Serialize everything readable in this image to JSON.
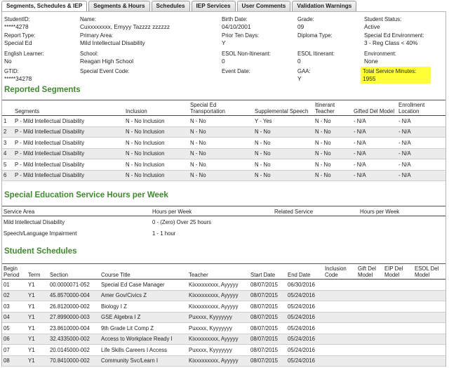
{
  "tabs": [
    {
      "label": "Segments, Schedules & IEP",
      "active": true
    },
    {
      "label": "Segments & Hours",
      "active": false
    },
    {
      "label": "Schedules",
      "active": false
    },
    {
      "label": "IEP Services",
      "active": false
    },
    {
      "label": "User Comments",
      "active": false
    },
    {
      "label": "Validation Warnings",
      "active": false
    }
  ],
  "student": {
    "student_id_label": "StudentID:",
    "student_id": "*****4278",
    "name_label": "Name:",
    "name": "Cuxxxxxxxx, Emyyy Tazzzz zzzzzz",
    "birth_label": "Birth Date:",
    "birth": "04/10/2001",
    "grade_label": "Grade:",
    "grade": "09",
    "status_label": "Student Status:",
    "status": "Active",
    "report_type_label": "Report Type:",
    "report_type": "Special Ed",
    "primary_area_label": "Primary Area:",
    "primary_area": "Mild Intellectual Disability",
    "prior_days_label": "Prior Ten Days:",
    "prior_days": "Y",
    "diploma_label": "Diploma Type:",
    "diploma": "",
    "sped_env_label": "Special Ed Environment:",
    "sped_env": "3 - Reg Class < 40%",
    "el_label": "English Learner:",
    "el": "No",
    "school_label": "School:",
    "school": "Reagan High School",
    "esol_non_label": "ESOL Non-Itinerant:",
    "esol_non": "0",
    "esol_itin_label": "ESOL Itinerant:",
    "esol_itin": "0",
    "environment_label": "Environment:",
    "environment": "None",
    "gtid_label": "GTID:",
    "gtid": "*****34278",
    "special_event_label": "Special Event Code:",
    "special_event": "",
    "event_date_label": "Event Date:",
    "event_date": "",
    "gaa_label": "GAA:",
    "gaa": "Y",
    "total_minutes_label": "Total Service Minutes:",
    "total_minutes": "1955"
  },
  "reported_segments": {
    "title": "Reported Segments",
    "headers": [
      "",
      "Segments",
      "Inclusion",
      "Special Ed Transportation",
      "Supplemental Speech",
      "Itinerant Teacher",
      "Gifted Del Model",
      "Enrollment Location"
    ],
    "rows": [
      [
        "1",
        "P - Mild Intellectual Disability",
        "N - No Inclusion",
        "N - No",
        "Y - Yes",
        "N - No",
        "- N/A",
        "- N/A"
      ],
      [
        "2",
        "P - Mild Intellectual Disability",
        "N - No Inclusion",
        "N - No",
        "N - No",
        "N - No",
        "- N/A",
        "- N/A"
      ],
      [
        "3",
        "P - Mild Intellectual Disability",
        "N - No Inclusion",
        "N - No",
        "N - No",
        "N - No",
        "- N/A",
        "- N/A"
      ],
      [
        "4",
        "P - Mild Intellectual Disability",
        "N - No Inclusion",
        "N - No",
        "N - No",
        "N - No",
        "- N/A",
        "- N/A"
      ],
      [
        "5",
        "P - Mild Intellectual Disability",
        "N - No Inclusion",
        "N - No",
        "N - No",
        "N - No",
        "- N/A",
        "- N/A"
      ],
      [
        "6",
        "P - Mild Intellectual Disability",
        "N - No Inclusion",
        "N - No",
        "N - No",
        "N - No",
        "- N/A",
        "- N/A"
      ]
    ]
  },
  "service_hours": {
    "title": "Special Education Service Hours per Week",
    "headers": [
      "Service Area",
      "Hours per Week",
      "Related Service",
      "Hours per Week"
    ],
    "rows": [
      [
        "Mild Intellectual Disability",
        "0 - (Zero) Over 25 hours",
        "",
        ""
      ],
      [
        "Speech/Language Impairment",
        "1 - 1 hour",
        "",
        ""
      ]
    ]
  },
  "schedules": {
    "title": "Student Schedules",
    "headers": [
      "Begin Period",
      "Term",
      "Section",
      "Course Title",
      "Teacher",
      "Start Date",
      "End Date",
      "Inclusion Code",
      "Gift Del Model",
      "EIP Del Model",
      "ESOL Del Model"
    ],
    "rows": [
      [
        "01",
        "Y1",
        "00.0000071-052",
        "Special Ed Case Manager",
        "Kixxxxxxxxx, Ayyyyy",
        "08/07/2015",
        "06/30/2016",
        "",
        "",
        "",
        ""
      ],
      [
        "02",
        "Y1",
        "45.8570000-004",
        "Amer Gov/Civics Z",
        "Kixxxxxxxxx, Ayyyyy",
        "08/07/2015",
        "05/24/2016",
        "",
        "",
        "",
        ""
      ],
      [
        "03",
        "Y1",
        "26.8120000-002",
        "Biology I Z",
        "Kixxxxxxxxx, Ayyyyy",
        "08/07/2015",
        "05/24/2016",
        "",
        "",
        "",
        ""
      ],
      [
        "04",
        "Y1",
        "27.8990000-003",
        "GSE Algebra I Z",
        "Puxxxx, Kyyyyyyy",
        "08/07/2015",
        "05/24/2016",
        "",
        "",
        "",
        ""
      ],
      [
        "05",
        "Y1",
        "23.8610000-004",
        "9th Grade Lit Comp Z",
        "Puxxxx, Kyyyyyyy",
        "08/07/2015",
        "05/24/2016",
        "",
        "",
        "",
        ""
      ],
      [
        "06",
        "Y1",
        "32.4335000-002",
        "Access to Workplace Ready I",
        "Kixxxxxxxxx, Ayyyyy",
        "08/07/2015",
        "05/24/2016",
        "",
        "",
        "",
        ""
      ],
      [
        "07",
        "Y1",
        "20.0145000-002",
        "Life Skills Careers I Access",
        "Puxxxx, Kyyyyyyy",
        "08/07/2015",
        "05/24/2016",
        "",
        "",
        "",
        ""
      ],
      [
        "08",
        "Y1",
        "70.8410000-002",
        "Community Svc/Learn I",
        "Kixxxxxxxxx, Ayyyyy",
        "08/07/2015",
        "05/24/2016",
        "",
        "",
        "",
        ""
      ]
    ]
  }
}
